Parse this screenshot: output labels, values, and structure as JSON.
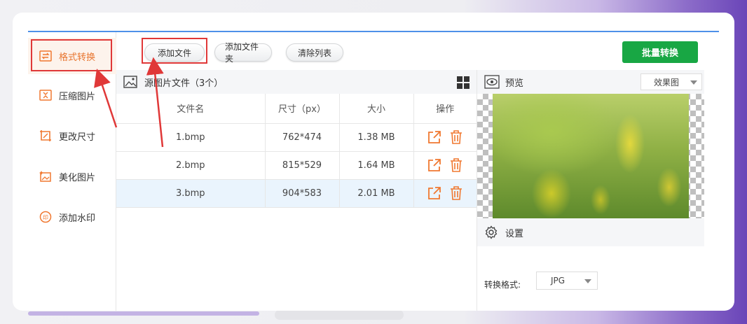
{
  "sidebar": {
    "items": [
      {
        "label": "格式转换",
        "icon": "swap-icon"
      },
      {
        "label": "压缩图片",
        "icon": "compress-icon"
      },
      {
        "label": "更改尺寸",
        "icon": "resize-icon"
      },
      {
        "label": "美化图片",
        "icon": "beautify-icon"
      },
      {
        "label": "添加水印",
        "icon": "watermark-icon"
      }
    ]
  },
  "toolbar": {
    "add_file": "添加文件",
    "add_folder": "添加文件夹",
    "clear_list": "清除列表",
    "batch_convert": "批量转换"
  },
  "filelist": {
    "title": "源图片文件（3个）",
    "columns": [
      "文件名",
      "尺寸（px）",
      "大小",
      "操作"
    ],
    "rows": [
      {
        "name": "1.bmp",
        "size_px": "762*474",
        "size": "1.38 MB"
      },
      {
        "name": "2.bmp",
        "size_px": "815*529",
        "size": "1.64 MB"
      },
      {
        "name": "3.bmp",
        "size_px": "904*583",
        "size": "2.01 MB"
      }
    ]
  },
  "preview": {
    "title": "预览",
    "mode": "效果图"
  },
  "settings": {
    "title": "设置",
    "format_label": "转换格式:",
    "format_value": "JPG"
  },
  "colors": {
    "accent": "#e8752f",
    "highlight_border": "#e03838",
    "batch_button": "#18a744",
    "top_border": "#4d90e8"
  }
}
